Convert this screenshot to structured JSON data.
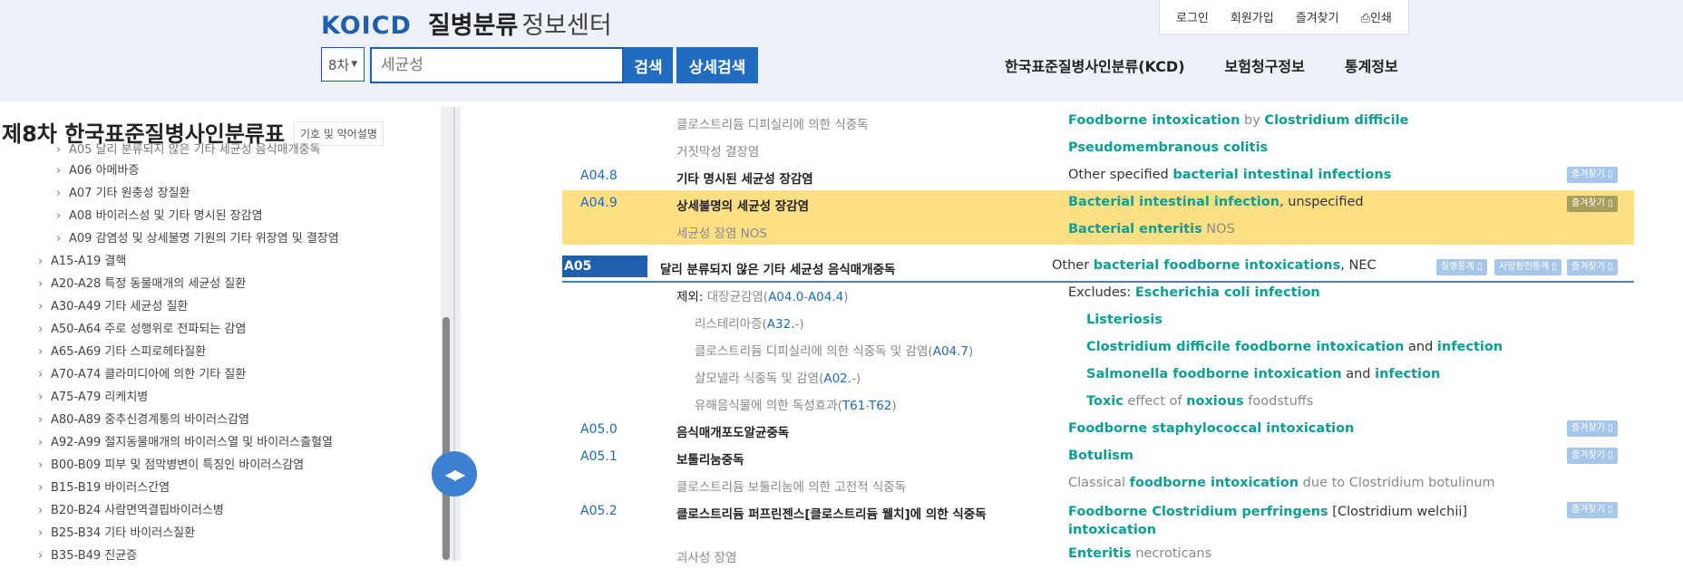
{
  "header": {
    "brand": "KOICD",
    "title_bold": "질병분류",
    "title_light": "정보센터",
    "util": [
      "로그인",
      "회원가입",
      "즐겨찾기",
      "인쇄"
    ],
    "version": "8차",
    "search_placeholder": "세균성",
    "search_btn": "검색",
    "adv_btn": "상세검색",
    "nav": [
      "한국표준질병사인분류(KCD)",
      "보험청구정보",
      "통계정보"
    ]
  },
  "sidebar": {
    "title": "제8차 한국표준질병사인분류표",
    "legend_btn": "기호 및 약어설명",
    "items": [
      {
        "label": "A05 달리 분류되지 않은 기타 세균성 음식매개중독",
        "level": 2
      },
      {
        "label": "A06 아메바증",
        "level": 2
      },
      {
        "label": "A07 기타 원충성 장질환",
        "level": 2
      },
      {
        "label": "A08 바이러스성 및 기타 명시된 장감염",
        "level": 2
      },
      {
        "label": "A09 감염성 및 상세불명 기원의 기타 위장염 및 결장염",
        "level": 2
      },
      {
        "label": "A15-A19 결핵",
        "level": 1
      },
      {
        "label": "A20-A28 특정 동물매개의 세균성 질환",
        "level": 1
      },
      {
        "label": "A30-A49 기타 세균성 질환",
        "level": 1
      },
      {
        "label": "A50-A64 주로 성행위로 전파되는 감염",
        "level": 1
      },
      {
        "label": "A65-A69 기타 스피로헤타질환",
        "level": 1
      },
      {
        "label": "A70-A74 클라미디아에 의한 기타 질환",
        "level": 1
      },
      {
        "label": "A75-A79 리케치병",
        "level": 1
      },
      {
        "label": "A80-A89 중추신경계통의 바이러스감염",
        "level": 1
      },
      {
        "label": "A92-A99 절지동물매개의 바이러스열 및 바이러스출혈열",
        "level": 1
      },
      {
        "label": "B00-B09 피부 및 점막병변이 특징인 바이러스감염",
        "level": 1
      },
      {
        "label": "B15-B19 바이러스간염",
        "level": 1
      },
      {
        "label": "B20-B24 사람면역결핍바이러스병",
        "level": 1
      },
      {
        "label": "B25-B34 기타 바이러스질환",
        "level": 1
      },
      {
        "label": "B35-B49 진균증",
        "level": 1
      }
    ]
  },
  "rows": {
    "r1_kr": "클로스트리듐 디피실리에 의한 식중독",
    "r1_en_a": "Foodborne intoxication",
    "r1_en_b": " by ",
    "r1_en_c": "Clostridium difficile",
    "r2_kr": "거짓막성 결장염",
    "r2_en": "Pseudomembranous colitis",
    "r3_code": "A04.8",
    "r3_kr": "기타 명시된 세균성 장감염",
    "r3_en_a": "Other specified ",
    "r3_en_b": "bacterial intestinal infections",
    "r4_code": "A04.9",
    "r4_kr": "상세불명의 세균성 장감염",
    "r4_en_a": "Bacterial intestinal infection",
    "r4_en_b": ", unspecified",
    "r5_kr": "세균성 장염 NOS",
    "r5_en_a": "Bacterial enteritis",
    "r5_en_b": " NOS",
    "r6_code": "A05",
    "r6_kr": "달리 분류되지 않은 기타 세균성 음식매개중독",
    "r6_en_a": "Other ",
    "r6_en_b": "bacterial foodborne intoxications",
    "r6_en_c": ", NEC",
    "r7_kr_a": "제외: ",
    "r7_kr_b": "대장균감염(",
    "r7_kr_c": "A04.0",
    "r7_kr_d": "-",
    "r7_kr_e": "A04.4",
    "r7_kr_f": ")",
    "r7_en_a": "Excludes: ",
    "r7_en_b": "Escherichia coli infection",
    "r8_kr_a": "리스테리아증(",
    "r8_kr_b": "A32.",
    "r8_kr_c": "-)",
    "r8_en": "Listeriosis",
    "r9_kr_a": "클로스트리듐 디피실리에 의한 식중독 및 감염(",
    "r9_kr_b": "A04.7",
    "r9_kr_c": ")",
    "r9_en_a": "Clostridium difficile foodborne intoxication",
    "r9_en_b": " and ",
    "r9_en_c": "infection",
    "r10_kr_a": "살모넬라 식중독 및 감염(",
    "r10_kr_b": "A02.",
    "r10_kr_c": "-)",
    "r10_en_a": "Salmonella foodborne intoxication",
    "r10_en_b": " and ",
    "r10_en_c": "infection",
    "r11_kr_a": "유해음식물에 의한 독성효과(",
    "r11_kr_b": "T61",
    "r11_kr_c": "-",
    "r11_kr_d": "T62",
    "r11_kr_e": ")",
    "r11_en_a": "Toxic",
    "r11_en_b": " effect of ",
    "r11_en_c": "noxious",
    "r11_en_d": " foodstuffs",
    "r12_code": "A05.0",
    "r12_kr": "음식매개포도알균중독",
    "r12_en": "Foodborne staphylococcal intoxication",
    "r13_code": "A05.1",
    "r13_kr": "보툴리눔중독",
    "r13_en": "Botulism",
    "r14_kr": "클로스트리듐 보툴리눔에 의한 고전적 식중독",
    "r14_en_a": "Classical ",
    "r14_en_b": "foodborne intoxication",
    "r14_en_c": " due to Clostridium botulinum",
    "r15_code": "A05.2",
    "r15_kr": "클로스트리듐 퍼프린젠스[클로스트리듐 웰치]에 의한 식중독",
    "r15_en_a": "Foodborne Clostridium perfringens",
    "r15_en_b": " [Clostridium welchii]",
    "r15_en_c": "intoxication",
    "r16_kr": "괴사성 장염",
    "r16_en_a": "Enteritis",
    "r16_en_b": " necroticans"
  },
  "badges": {
    "fav": "즐겨찾기",
    "disease_stat": "질병통계",
    "death_stat": "사망원인통계"
  }
}
